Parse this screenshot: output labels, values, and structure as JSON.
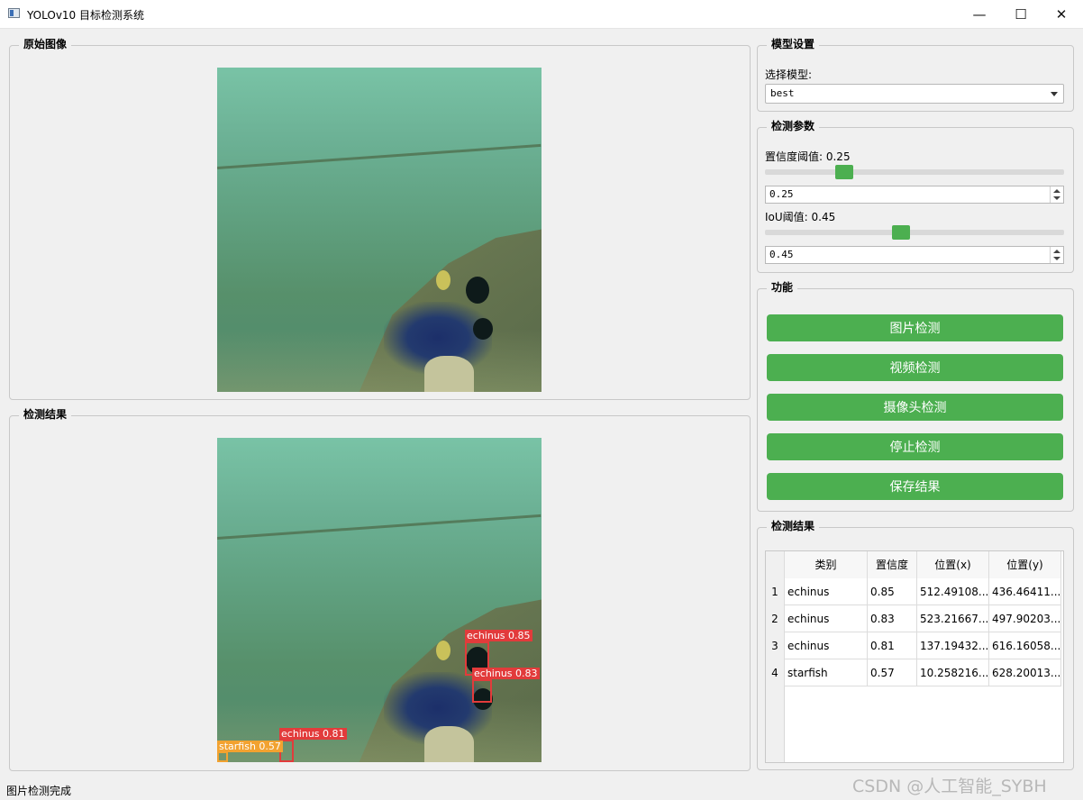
{
  "window": {
    "title": "YOLOv10 目标检测系统",
    "icon": "app-icon",
    "controls": {
      "minimize": "—",
      "maximize": "☐",
      "close": "✕"
    }
  },
  "original_panel": {
    "title": "原始图像"
  },
  "result_panel": {
    "title": "检测结果",
    "detections": [
      {
        "label": "echinus 0.85",
        "color": "#e23b3b"
      },
      {
        "label": "echinus 0.83",
        "color": "#e23b3b"
      },
      {
        "label": "echinus 0.81",
        "color": "#e23b3b"
      },
      {
        "label": "starfish 0.57",
        "color": "#f2a230"
      }
    ]
  },
  "model_settings": {
    "title": "模型设置",
    "select_label": "选择模型:",
    "selected_model": "best"
  },
  "detection_params": {
    "title": "检测参数",
    "conf_label": "置信度阈值: 0.25",
    "conf_value": "0.25",
    "conf_level": 0.25,
    "iou_label": "IoU阈值: 0.45",
    "iou_value": "0.45",
    "iou_level": 0.45
  },
  "functions": {
    "title": "功能",
    "image_detect": "图片检测",
    "video_detect": "视频检测",
    "camera_detect": "摄像头检测",
    "stop_detect": "停止检测",
    "save_result": "保存结果",
    "button_color": "#4caf50"
  },
  "results_table": {
    "title": "检测结果",
    "headers": [
      "类别",
      "置信度",
      "位置(x)",
      "位置(y)"
    ],
    "rows": [
      {
        "num": "1",
        "cls": "echinus",
        "conf": "0.85",
        "x": "512.49108...",
        "y": "436.46411..."
      },
      {
        "num": "2",
        "cls": "echinus",
        "conf": "0.83",
        "x": "523.21667...",
        "y": "497.90203..."
      },
      {
        "num": "3",
        "cls": "echinus",
        "conf": "0.81",
        "x": "137.19432...",
        "y": "616.16058..."
      },
      {
        "num": "4",
        "cls": "starfish",
        "conf": "0.57",
        "x": "10.258216...",
        "y": "628.20013..."
      }
    ]
  },
  "status_bar": {
    "text": "图片检测完成"
  },
  "watermark": "CSDN @人工智能_SYBH"
}
